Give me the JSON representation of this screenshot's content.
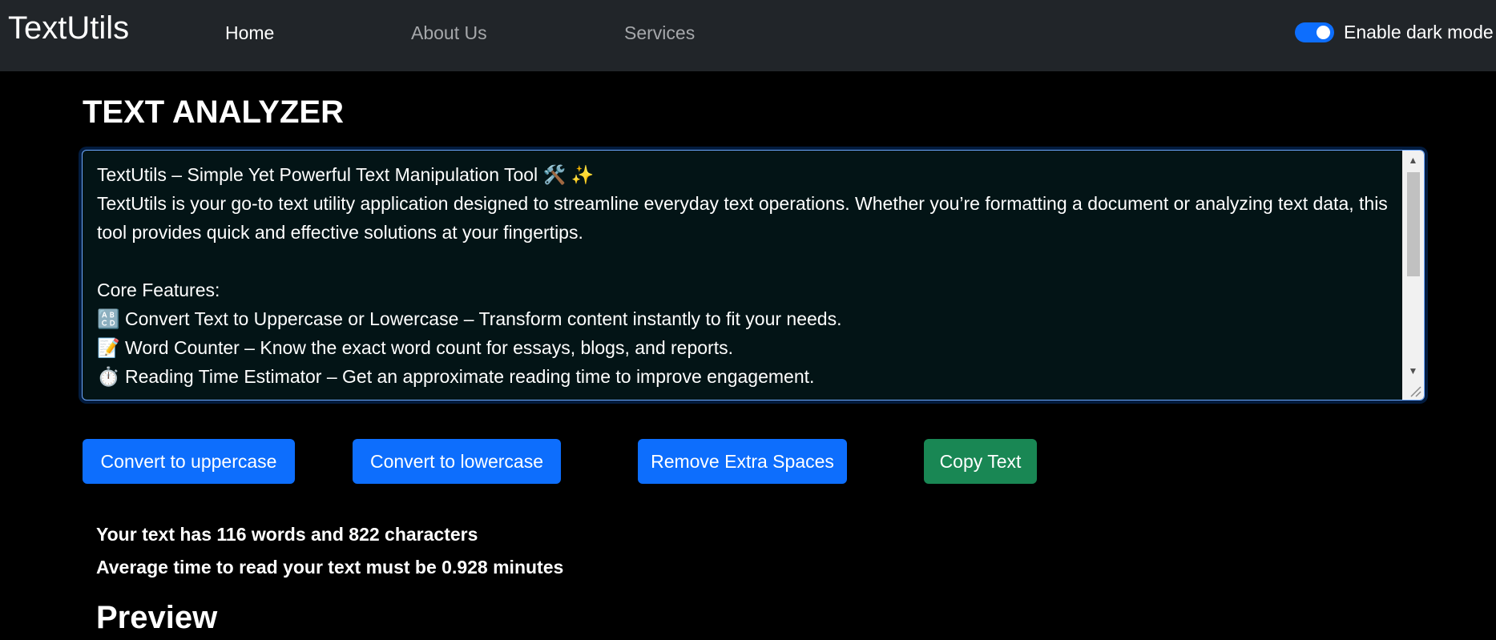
{
  "navbar": {
    "brand": "TextUtils",
    "links": [
      {
        "label": "Home",
        "active": true
      },
      {
        "label": "About Us",
        "active": false
      },
      {
        "label": "Services",
        "active": false
      }
    ],
    "dark_mode": {
      "label": "Enable dark mode",
      "enabled": true
    }
  },
  "main": {
    "title": "TEXT ANALYZER",
    "textarea": {
      "value": "TextUtils – Simple Yet Powerful Text Manipulation Tool 🛠️ ✨\nTextUtils is your go-to text utility application designed to streamline everyday text operations. Whether you’re formatting a document or analyzing text data, this tool provides quick and effective solutions at your fingertips.\n\nCore Features:\n🔠 Convert Text to Uppercase or Lowercase – Transform content instantly to fit your needs.\n📝 Word Counter – Know the exact word count for essays, blogs, and reports.\n⏱️ Reading Time Estimator – Get an approximate reading time to improve engagement."
    },
    "buttons": {
      "uppercase": "Convert to uppercase",
      "lowercase": "Convert to lowercase",
      "remove_spaces": "Remove Extra Spaces",
      "copy": "Copy Text"
    },
    "summary": {
      "counts": "Your text has 116 words and 822 characters",
      "reading_time": "Average time to read your text must be 0.928 minutes"
    },
    "preview_title": "Preview"
  },
  "colors": {
    "navbar_bg": "#212529",
    "page_bg": "#000000",
    "textarea_bg": "#031416",
    "primary": "#0d6efd",
    "success": "#198754"
  }
}
